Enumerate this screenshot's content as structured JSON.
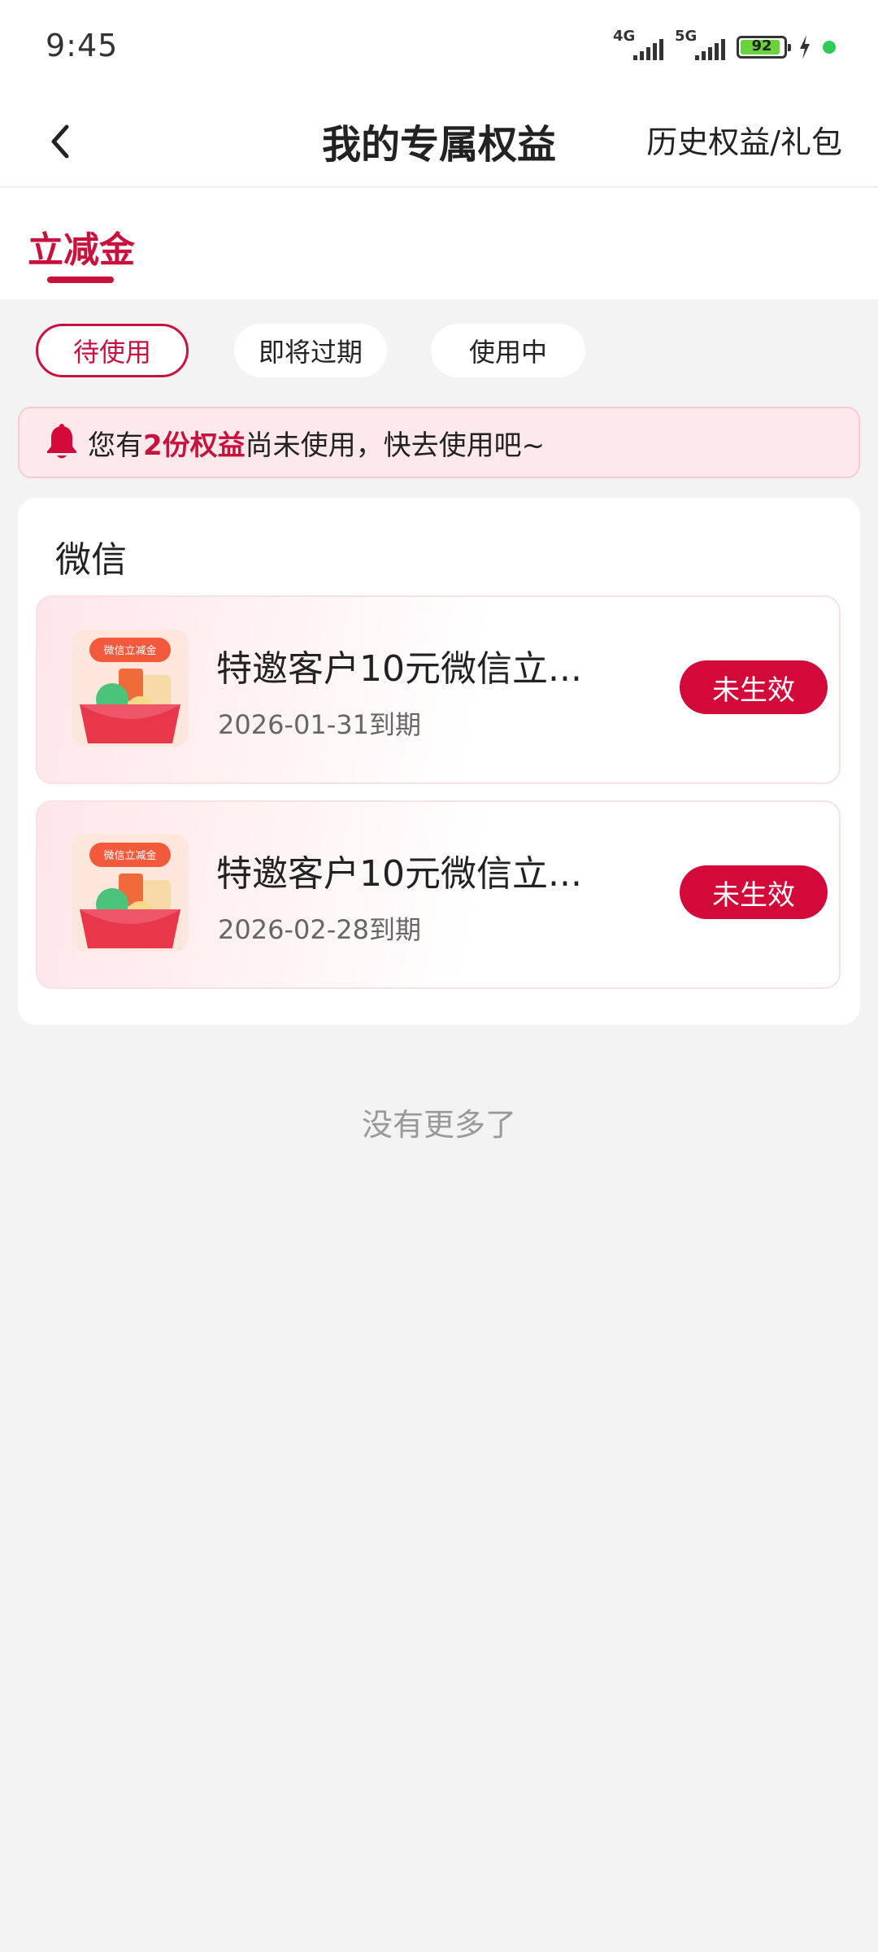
{
  "status_bar": {
    "time": "9:45",
    "net1": "4G",
    "net2": "5G",
    "battery": "92",
    "battery_level": 0.92
  },
  "nav": {
    "back_icon": "chevron-left-icon",
    "title": "我的专属权益",
    "history_link": "历史权益/礼包"
  },
  "tabs": [
    {
      "label": "立减金",
      "active": true
    }
  ],
  "filters": [
    {
      "label": "待使用",
      "active": true
    },
    {
      "label": "即将过期",
      "active": false
    },
    {
      "label": "使用中",
      "active": false
    }
  ],
  "notice": {
    "icon": "bell-icon",
    "prefix": "您有",
    "highlight": "2份权益",
    "suffix": "尚未使用，快去使用吧~"
  },
  "group": {
    "title": "微信",
    "items": [
      {
        "thumb_label": "微信立减金",
        "title": "特邀客户10元微信立...",
        "date": "2026-01-31到期",
        "status": "未生效"
      },
      {
        "thumb_label": "微信立减金",
        "title": "特邀客户10元微信立...",
        "date": "2026-02-28到期",
        "status": "未生效"
      }
    ]
  },
  "footer": {
    "end_text": "没有更多了"
  },
  "colors": {
    "accent": "#c8123d",
    "button": "#d30a39",
    "background": "#f3f3f3"
  }
}
